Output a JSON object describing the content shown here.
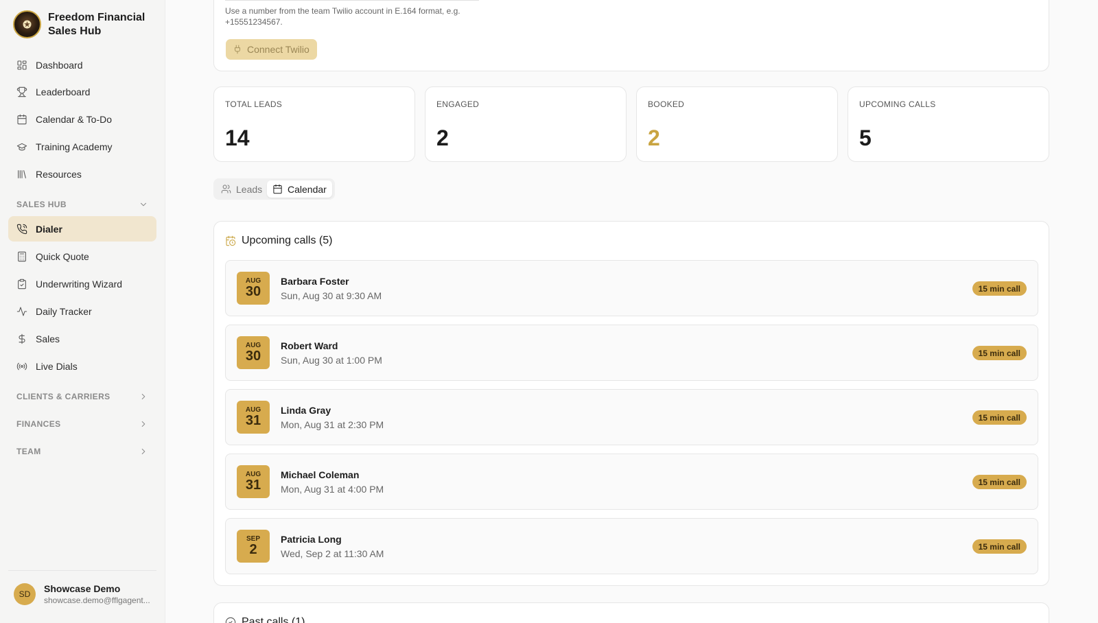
{
  "brand": {
    "title": "Freedom Financial Sales Hub",
    "logo_icon": "eagle-seal-logo"
  },
  "nav_top": [
    {
      "label": "Dashboard",
      "icon": "dashboard-icon"
    },
    {
      "label": "Leaderboard",
      "icon": "trophy-icon"
    },
    {
      "label": "Calendar & To-Do",
      "icon": "calendar-icon"
    },
    {
      "label": "Training Academy",
      "icon": "graduation-cap-icon"
    },
    {
      "label": "Resources",
      "icon": "library-icon"
    }
  ],
  "sections": {
    "sales_hub": "SALES HUB",
    "clients_carriers": "CLIENTS & CARRIERS",
    "finances": "FINANCES",
    "team": "TEAM"
  },
  "nav_sales": [
    {
      "label": "Dialer",
      "icon": "phone-icon",
      "active": true
    },
    {
      "label": "Quick Quote",
      "icon": "calculator-icon"
    },
    {
      "label": "Underwriting Wizard",
      "icon": "clipboard-check-icon"
    },
    {
      "label": "Daily Tracker",
      "icon": "activity-icon"
    },
    {
      "label": "Sales",
      "icon": "dollar-icon"
    },
    {
      "label": "Live Dials",
      "icon": "radio-icon"
    }
  ],
  "user": {
    "initials": "SD",
    "name": "Showcase Demo",
    "email": "showcase.demo@fflgagent..."
  },
  "twilio": {
    "hint": "Use a number from the team Twilio account in E.164 format, e.g. +15551234567.",
    "connect_label": "Connect Twilio"
  },
  "stats": [
    {
      "label": "TOTAL LEADS",
      "value": "14",
      "color": "#1c1c1c"
    },
    {
      "label": "ENGAGED",
      "value": "2",
      "color": "#1c1c1c"
    },
    {
      "label": "BOOKED",
      "value": "2",
      "color": "#c9a441"
    },
    {
      "label": "UPCOMING CALLS",
      "value": "5",
      "color": "#1c1c1c"
    }
  ],
  "tabs": {
    "leads": "Leads",
    "calendar": "Calendar",
    "active": "Calendar"
  },
  "upcoming": {
    "title": "Upcoming calls (5)",
    "calls": [
      {
        "month": "AUG",
        "day": "30",
        "name": "Barbara Foster",
        "time": "Sun, Aug 30 at 9:30 AM",
        "duration": "15 min call"
      },
      {
        "month": "AUG",
        "day": "30",
        "name": "Robert Ward",
        "time": "Sun, Aug 30 at 1:00 PM",
        "duration": "15 min call"
      },
      {
        "month": "AUG",
        "day": "31",
        "name": "Linda Gray",
        "time": "Mon, Aug 31 at 2:30 PM",
        "duration": "15 min call"
      },
      {
        "month": "AUG",
        "day": "31",
        "name": "Michael Coleman",
        "time": "Mon, Aug 31 at 4:00 PM",
        "duration": "15 min call"
      },
      {
        "month": "SEP",
        "day": "2",
        "name": "Patricia Long",
        "time": "Wed, Sep 2 at 11:30 AM",
        "duration": "15 min call"
      }
    ]
  },
  "past": {
    "title": "Past calls (1)"
  },
  "colors": {
    "accent": "#d7ab4e",
    "active_nav_bg": "#f1e6cf",
    "booked_value": "#c9a441"
  }
}
